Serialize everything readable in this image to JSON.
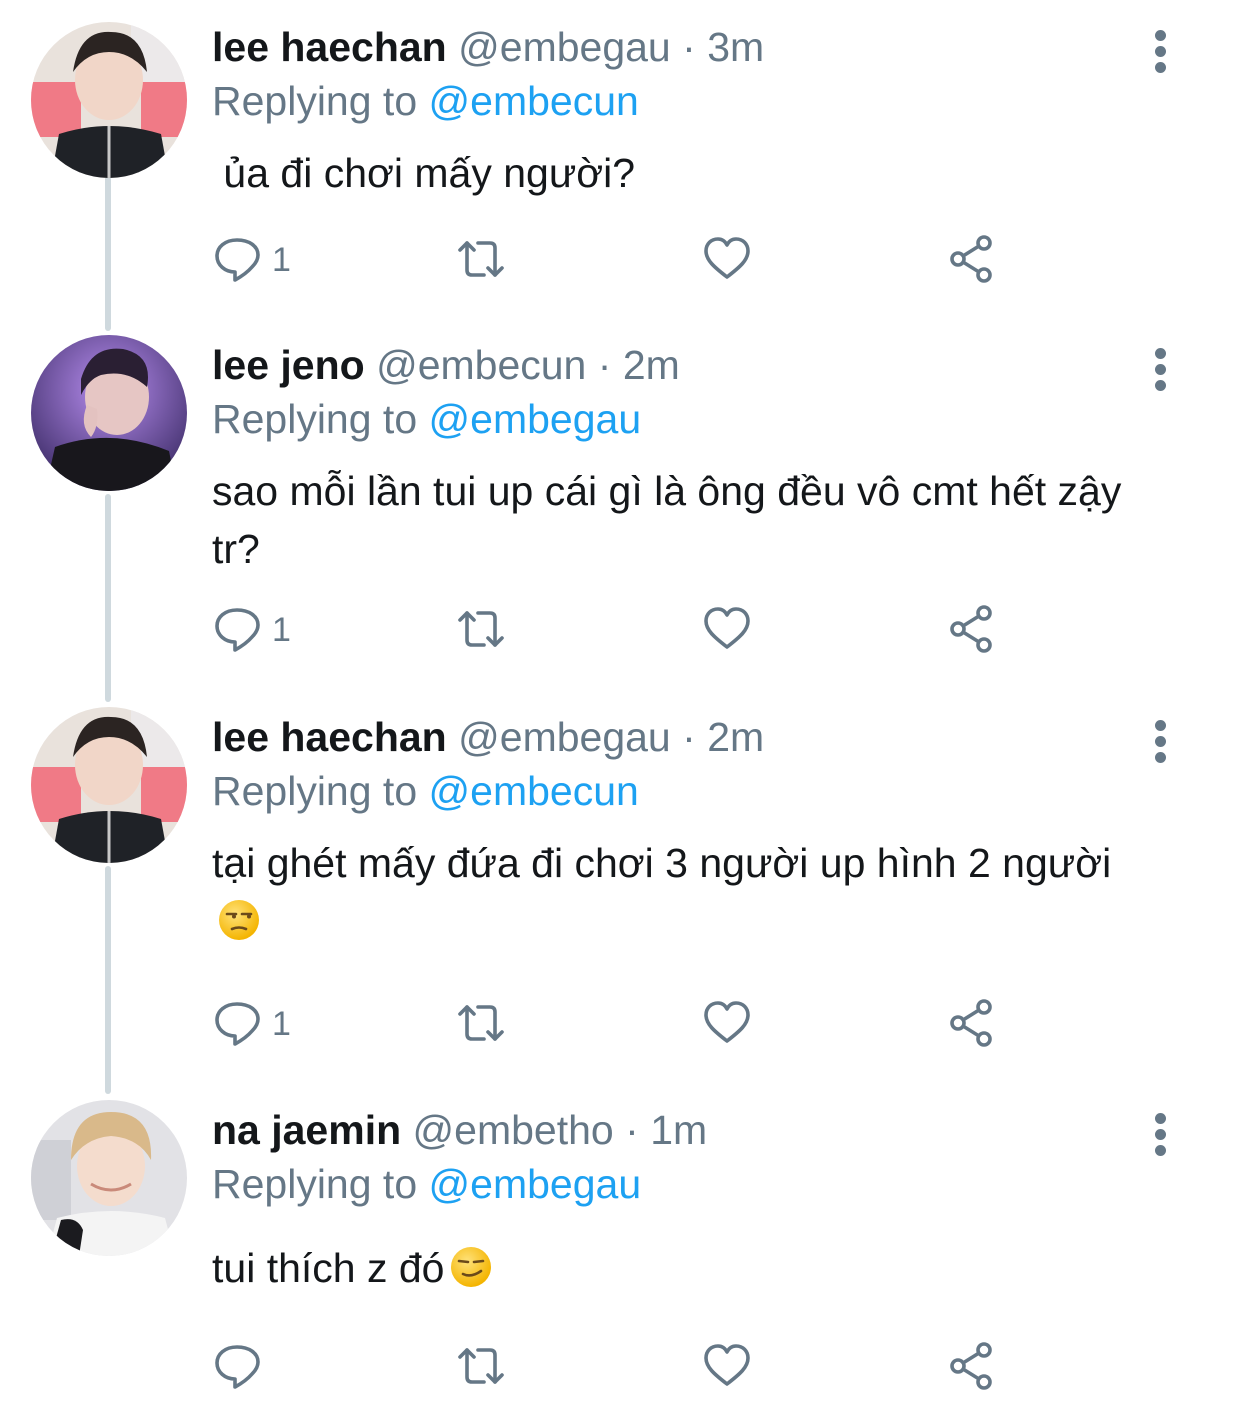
{
  "reply_prefix": "Replying to",
  "tweets": [
    {
      "name": "lee haechan",
      "handle": "@embegau",
      "time": "3m",
      "replying_to": "@embecun",
      "text": " ủa đi chơi mấy người?",
      "emoji": "",
      "reply_count": "1"
    },
    {
      "name": "lee jeno",
      "handle": "@embecun",
      "time": "2m",
      "replying_to": "@embegau",
      "text": "sao mỗi lần tui up cái gì là ông đều vô cmt hết zậy tr?",
      "emoji": "",
      "reply_count": "1"
    },
    {
      "name": "lee haechan",
      "handle": "@embegau",
      "time": "2m",
      "replying_to": "@embecun",
      "text": "tại ghét mấy đứa đi chơi 3 người up hình 2 người",
      "emoji": "unamused-face",
      "reply_count": "1"
    },
    {
      "name": "na jaemin",
      "handle": "@embetho",
      "time": "1m",
      "replying_to": "@embegau",
      "text": "tui thích z đó",
      "emoji": "smirking-face",
      "reply_count": ""
    }
  ],
  "colors": {
    "name": "#14171a",
    "meta": "#657786",
    "link": "#1da1f2",
    "thread_line": "#cfd9de"
  },
  "icons": {
    "reply": "reply-icon",
    "retweet": "retweet-icon",
    "like": "heart-icon",
    "share": "share-icon",
    "more": "more-vertical-icon"
  }
}
